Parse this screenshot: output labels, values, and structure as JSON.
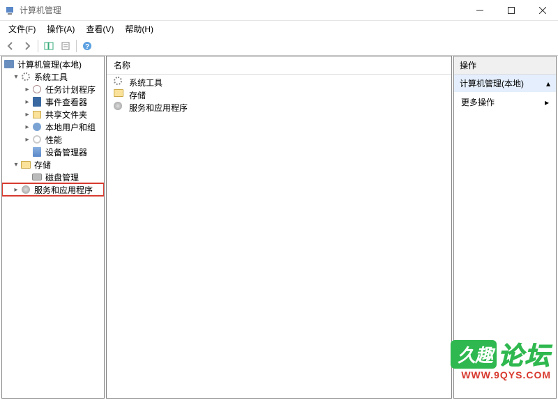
{
  "window": {
    "title": "计算机管理"
  },
  "menubar": {
    "file": "文件(F)",
    "action": "操作(A)",
    "view": "查看(V)",
    "help": "帮助(H)"
  },
  "tree": {
    "root": "计算机管理(本地)",
    "system_tools": "系统工具",
    "task_scheduler": "任务计划程序",
    "event_viewer": "事件查看器",
    "shared_folders": "共享文件夹",
    "local_users": "本地用户和组",
    "performance": "性能",
    "device_manager": "设备管理器",
    "storage": "存储",
    "disk_mgmt": "磁盘管理",
    "services_apps": "服务和应用程序"
  },
  "mid": {
    "column_header": "名称",
    "items": {
      "system_tools": "系统工具",
      "storage": "存储",
      "services_apps": "服务和应用程序"
    }
  },
  "actions": {
    "header": "操作",
    "section": "计算机管理(本地)",
    "more": "更多操作"
  },
  "watermark": {
    "badge": "久趣",
    "text": "论坛",
    "url": "WWW.9QYS.COM"
  }
}
